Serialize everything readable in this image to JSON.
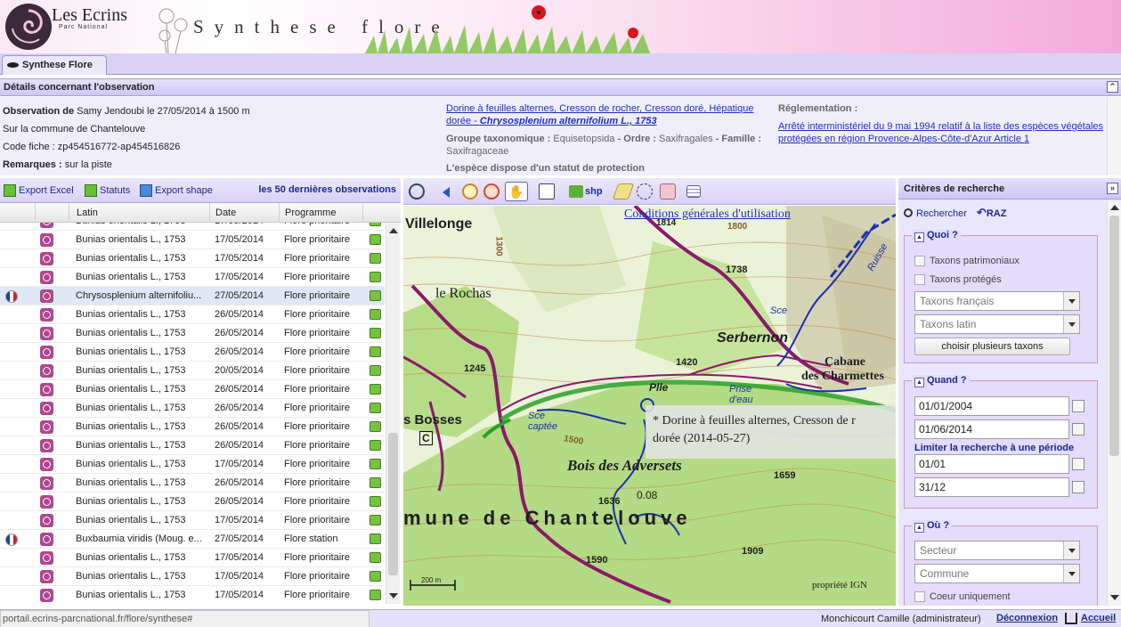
{
  "banner": {
    "logo_title": "Les Ecrins",
    "logo_subtitle": "Parc National",
    "app_title": "Synthese flore"
  },
  "tabs": [
    {
      "label": "Synthese Flore"
    }
  ],
  "details": {
    "header": "Détails concernant l'observation",
    "observation_label": "Observation de",
    "observation_value": "Samy Jendoubi le 27/05/2014 à 1500 m",
    "commune": "Sur la commune de Chantelouve",
    "code_fiche": "Code fiche : zp454516772-ap454516826",
    "remarques_label": "Remarques :",
    "remarques_value": "sur la piste",
    "taxon_link": "Dorine à feuilles alternes, Cresson de rocher, Cresson doré, Hépatique dorée -",
    "taxon_latin": "Chrysosplenium alternifolium L., 1753",
    "groupe_label": "Groupe taxonomique :",
    "groupe_value": "Equisetopsida",
    "ordre_label": "- Ordre :",
    "ordre_value": "Saxifragales",
    "famille_label": "- Famille :",
    "famille_value": "Saxifragaceae",
    "statut_text": "L'espèce dispose d'un statut de protection",
    "reglementation_label": "Réglementation :",
    "reglementation_link": "Arrêté interministériel du 9 mai 1994 relatif à la liste des espèces végétales protégées en région Provence-Alpes-Côte-d'Azur Article 1"
  },
  "list_toolbar": {
    "export_excel": "Export Excel",
    "statuts": "Statuts",
    "export_shape": "Export shape",
    "last_obs": "les 50 dernières observations"
  },
  "grid": {
    "columns": [
      "Latin",
      "Date",
      "Programme"
    ],
    "rows": [
      {
        "flag": false,
        "latin": "Bunias orientalis L., 1753",
        "date": "17/05/2014",
        "prog": "Flore prioritaire",
        "selected": false
      },
      {
        "flag": false,
        "latin": "Bunias orientalis L., 1753",
        "date": "17/05/2014",
        "prog": "Flore prioritaire",
        "selected": false
      },
      {
        "flag": false,
        "latin": "Bunias orientalis L., 1753",
        "date": "17/05/2014",
        "prog": "Flore prioritaire",
        "selected": false
      },
      {
        "flag": false,
        "latin": "Bunias orientalis L., 1753",
        "date": "17/05/2014",
        "prog": "Flore prioritaire",
        "selected": false
      },
      {
        "flag": true,
        "latin": "Chrysosplenium alternifoliu...",
        "date": "27/05/2014",
        "prog": "Flore prioritaire",
        "selected": true
      },
      {
        "flag": false,
        "latin": "Bunias orientalis L., 1753",
        "date": "26/05/2014",
        "prog": "Flore prioritaire",
        "selected": false
      },
      {
        "flag": false,
        "latin": "Bunias orientalis L., 1753",
        "date": "26/05/2014",
        "prog": "Flore prioritaire",
        "selected": false
      },
      {
        "flag": false,
        "latin": "Bunias orientalis L., 1753",
        "date": "26/05/2014",
        "prog": "Flore prioritaire",
        "selected": false
      },
      {
        "flag": false,
        "latin": "Bunias orientalis L., 1753",
        "date": "20/05/2014",
        "prog": "Flore prioritaire",
        "selected": false
      },
      {
        "flag": false,
        "latin": "Bunias orientalis L., 1753",
        "date": "26/05/2014",
        "prog": "Flore prioritaire",
        "selected": false
      },
      {
        "flag": false,
        "latin": "Bunias orientalis L., 1753",
        "date": "26/05/2014",
        "prog": "Flore prioritaire",
        "selected": false
      },
      {
        "flag": false,
        "latin": "Bunias orientalis L., 1753",
        "date": "26/05/2014",
        "prog": "Flore prioritaire",
        "selected": false
      },
      {
        "flag": false,
        "latin": "Bunias orientalis L., 1753",
        "date": "26/05/2014",
        "prog": "Flore prioritaire",
        "selected": false
      },
      {
        "flag": false,
        "latin": "Bunias orientalis L., 1753",
        "date": "17/05/2014",
        "prog": "Flore prioritaire",
        "selected": false
      },
      {
        "flag": false,
        "latin": "Bunias orientalis L., 1753",
        "date": "26/05/2014",
        "prog": "Flore prioritaire",
        "selected": false
      },
      {
        "flag": false,
        "latin": "Bunias orientalis L., 1753",
        "date": "26/05/2014",
        "prog": "Flore prioritaire",
        "selected": false
      },
      {
        "flag": false,
        "latin": "Bunias orientalis L., 1753",
        "date": "17/05/2014",
        "prog": "Flore prioritaire",
        "selected": false
      },
      {
        "flag": true,
        "latin": "Buxbaumia viridis (Moug. e...",
        "date": "27/05/2014",
        "prog": "Flore station",
        "selected": false
      },
      {
        "flag": false,
        "latin": "Bunias orientalis L., 1753",
        "date": "17/05/2014",
        "prog": "Flore prioritaire",
        "selected": false
      },
      {
        "flag": false,
        "latin": "Bunias orientalis L., 1753",
        "date": "17/05/2014",
        "prog": "Flore prioritaire",
        "selected": false
      },
      {
        "flag": false,
        "latin": "Bunias orientalis L., 1753",
        "date": "17/05/2014",
        "prog": "Flore prioritaire",
        "selected": false
      }
    ]
  },
  "map": {
    "shp_label": "shp",
    "cgu_link": "Conditions générales d'utilisation",
    "popup_line1": "* Dorine à feuilles alternes, Cresson de r",
    "popup_line2": "dorée (2014-05-27)",
    "copyright": "propriété IGN",
    "scale_label": "200 m",
    "labels": {
      "villelonge": "Villelonge",
      "rochas": "le Rochas",
      "serbernon": "Serbernon",
      "cabane": "Cabane",
      "charmettes": "des Charmettes",
      "bosses": "s Bosses",
      "bois": "Bois   des   Adversets",
      "commune": "mune de Chantelouve",
      "alt1738": "1738",
      "alt1420": "1420",
      "alt1636": "1636",
      "alt1659": "1659",
      "alt1909": "1909",
      "alt1590": "1590",
      "alt1245": "1245",
      "alt1814": "1814",
      "alt1800": "1800",
      "alt1300": "1300",
      "alt1500": "1500",
      "pile": "Plle",
      "prise": "Prise d'eau",
      "source": "Sce captée",
      "sce": "Sce",
      "val008": "0.08",
      "c": "C",
      "russeau": "Ruisse"
    }
  },
  "criteria": {
    "header": "Critères de recherche",
    "search_btn": "Rechercher",
    "raz_btn": "RAZ",
    "quoi": {
      "legend": "Quoi ?",
      "patrimoniaux": "Taxons patrimoniaux",
      "proteges": "Taxons protégés",
      "francais_placeholder": "Taxons français",
      "latin_placeholder": "Taxons latin",
      "multi_btn": "choisir plusieurs taxons"
    },
    "quand": {
      "legend": "Quand ?",
      "date_from": "01/01/2004",
      "date_to": "01/06/2014",
      "period_label": "Limiter la recherche à une période",
      "period_from": "01/01",
      "period_to": "31/12"
    },
    "ou": {
      "legend": "Où ?",
      "secteur_placeholder": "Secteur",
      "commune_placeholder": "Commune",
      "coeur": "Coeur uniquement"
    }
  },
  "status": {
    "url": "portail.ecrins-parcnational.fr/flore/synthese#",
    "user": "Monchicourt Camille (administrateur)",
    "logout": "Déconnexion",
    "home": "Accueil"
  },
  "colors": {
    "accent": "#d9d2f5",
    "link": "#1f2fbf",
    "map_track": "#8a1a6a",
    "map_route": "#2aa12a",
    "map_river": "#1a2fb0"
  }
}
